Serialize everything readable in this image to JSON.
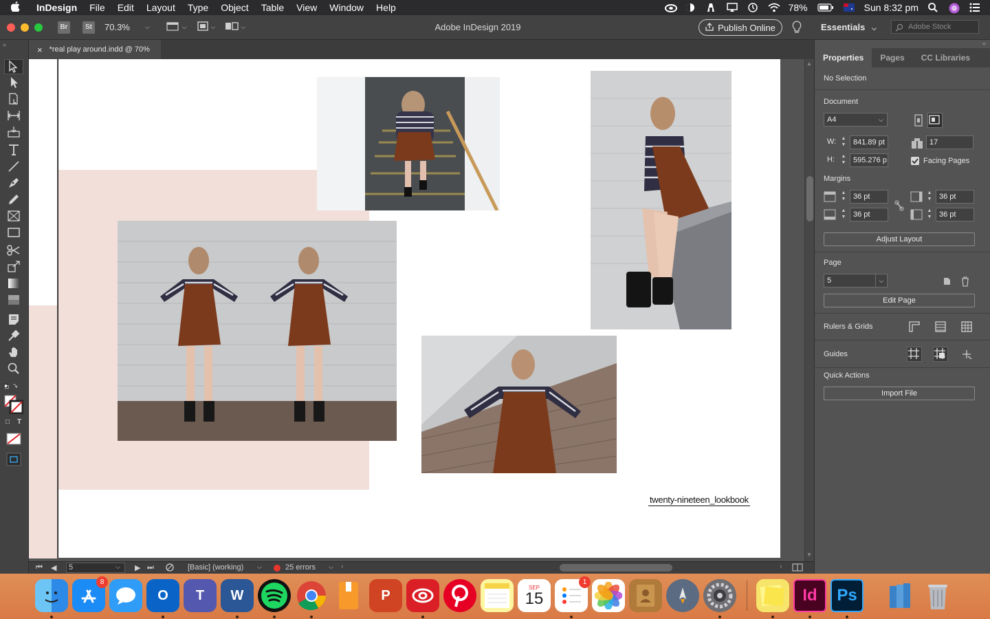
{
  "menubar": {
    "app_name": "InDesign",
    "items": [
      "File",
      "Edit",
      "Layout",
      "Type",
      "Object",
      "Table",
      "View",
      "Window",
      "Help"
    ],
    "battery": "78%",
    "clock": "Sun 8:32 pm"
  },
  "appbar": {
    "br_label": "Br",
    "st_label": "St",
    "zoom": "70.3%",
    "window_title": "Adobe InDesign 2019",
    "publish_label": "Publish Online",
    "workspace": "Essentials",
    "stock_placeholder": "Adobe Stock"
  },
  "doc_tab": {
    "close": "×",
    "name": "*real play around.indd @ 70%"
  },
  "canvas": {
    "caption": "twenty-nineteen_lookbook"
  },
  "statusbar": {
    "page": "5",
    "style": "[Basic] (working)",
    "errors": "25 errors"
  },
  "panel": {
    "tabs": [
      "Properties",
      "Pages",
      "CC Libraries"
    ],
    "selection": "No Selection",
    "document_label": "Document",
    "preset": "A4",
    "w_label": "W:",
    "width": "841.89 pt",
    "h_label": "H:",
    "height": "595.276 p",
    "page_count": "17",
    "facing_pages": "Facing Pages",
    "margins_label": "Margins",
    "margin_top": "36 pt",
    "margin_bottom": "36 pt",
    "margin_left": "36 pt",
    "margin_right": "36 pt",
    "adjust_layout": "Adjust Layout",
    "page_label": "Page",
    "page_value": "5",
    "edit_page": "Edit Page",
    "rulers_grids": "Rulers & Grids",
    "guides": "Guides",
    "quick_actions": "Quick Actions",
    "import_file": "Import File"
  },
  "dock": {
    "appstore_badge": "8",
    "reminders_badge": "1",
    "calendar_month": "SEP",
    "calendar_day": "15",
    "indesign_label": "Id",
    "photoshop_label": "Ps",
    "word_label": "W",
    "teams_label": "T",
    "outlook_label": "O",
    "powerpoint_label": "P"
  },
  "colors": {
    "canvas_pink": "#f2dfd9",
    "indesign_pink": "#ff3aa6",
    "photoshop_blue": "#31a8ff",
    "dress_rust": "#7b3a1c"
  }
}
